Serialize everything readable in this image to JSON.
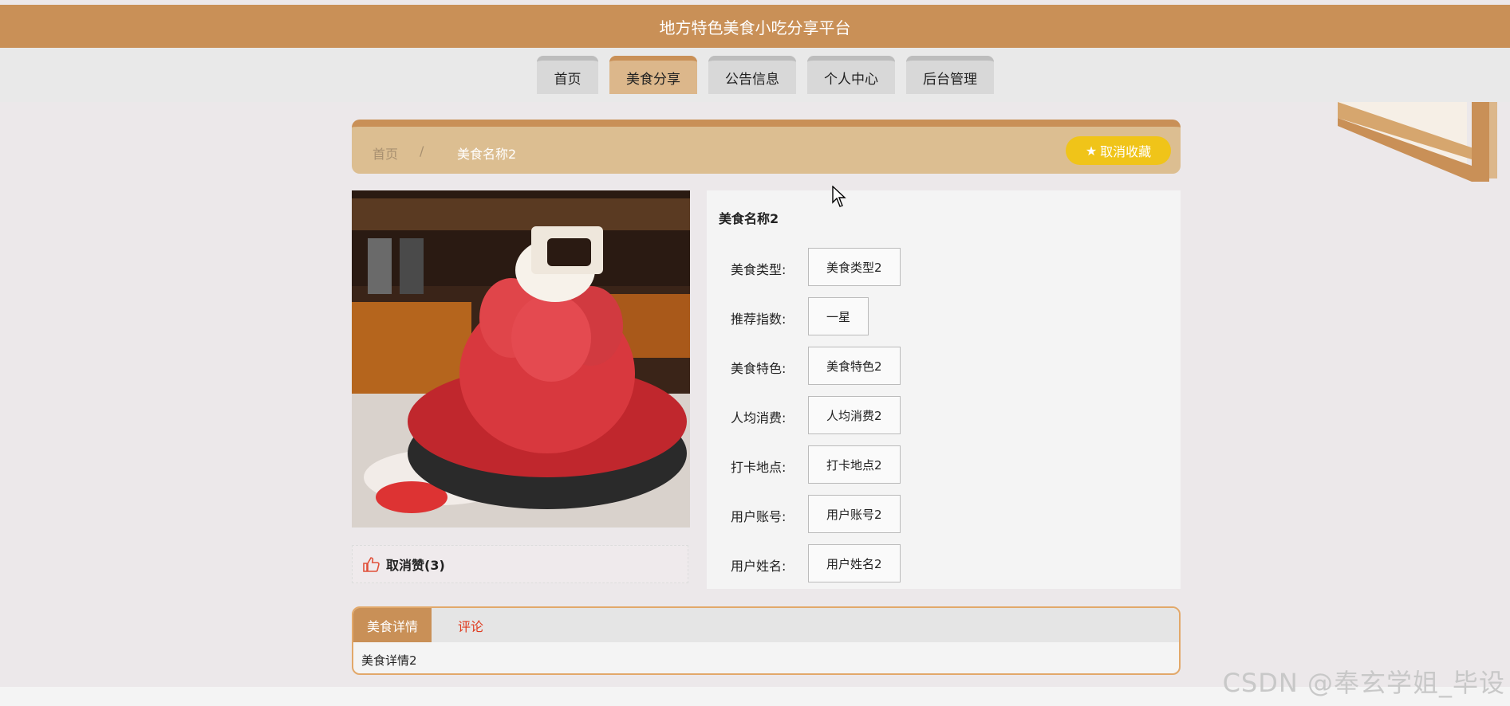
{
  "header": {
    "title": "地方特色美食小吃分享平台"
  },
  "nav": {
    "items": [
      {
        "label": "首页",
        "width": 77
      },
      {
        "label": "美食分享",
        "width": 110
      },
      {
        "label": "公告信息",
        "width": 110
      },
      {
        "label": "个人中心",
        "width": 110
      },
      {
        "label": "后台管理",
        "width": 110
      }
    ]
  },
  "breadcrumb": {
    "home": "首页",
    "separator": "/",
    "current": "美食名称2"
  },
  "fav_button": "取消收藏",
  "like": {
    "label": "取消赞(3)"
  },
  "info": {
    "title": "美食名称2",
    "fields": [
      {
        "label": "美食类型:",
        "value": "美食类型2"
      },
      {
        "label": "推荐指数:",
        "value": "一星"
      },
      {
        "label": "美食特色:",
        "value": "美食特色2"
      },
      {
        "label": "人均消费:",
        "value": "人均消费2"
      },
      {
        "label": "打卡地点:",
        "value": "打卡地点2"
      },
      {
        "label": "用户账号:",
        "value": "用户账号2"
      },
      {
        "label": "用户姓名:",
        "value": "用户姓名2"
      }
    ]
  },
  "tabs": {
    "detail": "美食详情",
    "comment": "评论",
    "content": "美食详情2"
  },
  "watermark": "CSDN @奉玄学姐_毕设",
  "colors": {
    "brand": "#c99057",
    "accent": "#f0c419",
    "comment_tab": "#e03a1e"
  }
}
